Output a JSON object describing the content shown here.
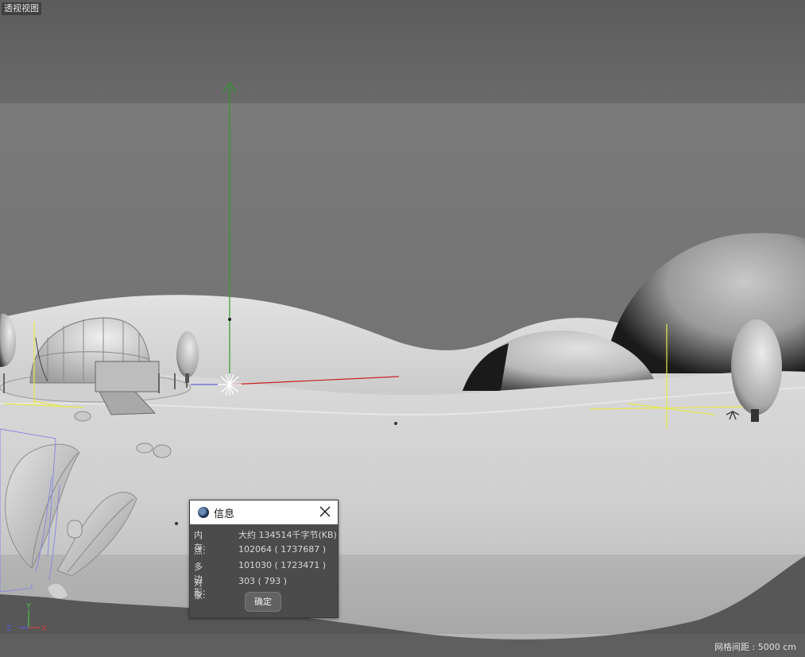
{
  "viewport": {
    "label": "透视视图",
    "grid_spacing": "网格间距 : 5000 cm",
    "axis_labels": {
      "y": "Y",
      "z": "Z",
      "x": "X"
    }
  },
  "dialog": {
    "title": "信息",
    "rows": [
      {
        "label": "内存:",
        "value": "大约 134514千字节(KB)"
      },
      {
        "label": "点:",
        "value": "102064 ( 1737687 )"
      },
      {
        "label": "多边形:",
        "value": "101030 ( 1723471 )"
      },
      {
        "label": "对象:",
        "value": "303 ( 793 )"
      }
    ],
    "ok_label": "确定"
  },
  "colors": {
    "background_top": "#5e5e5e",
    "floor": "#6f6f6f",
    "axis_y": "#2e9b2e",
    "axis_x": "#c82020",
    "selection": "#e8e84a",
    "bbox": "#8a8ae0"
  },
  "icons": [
    "cinema4d-app-icon",
    "close-icon",
    "light-star-icon"
  ]
}
